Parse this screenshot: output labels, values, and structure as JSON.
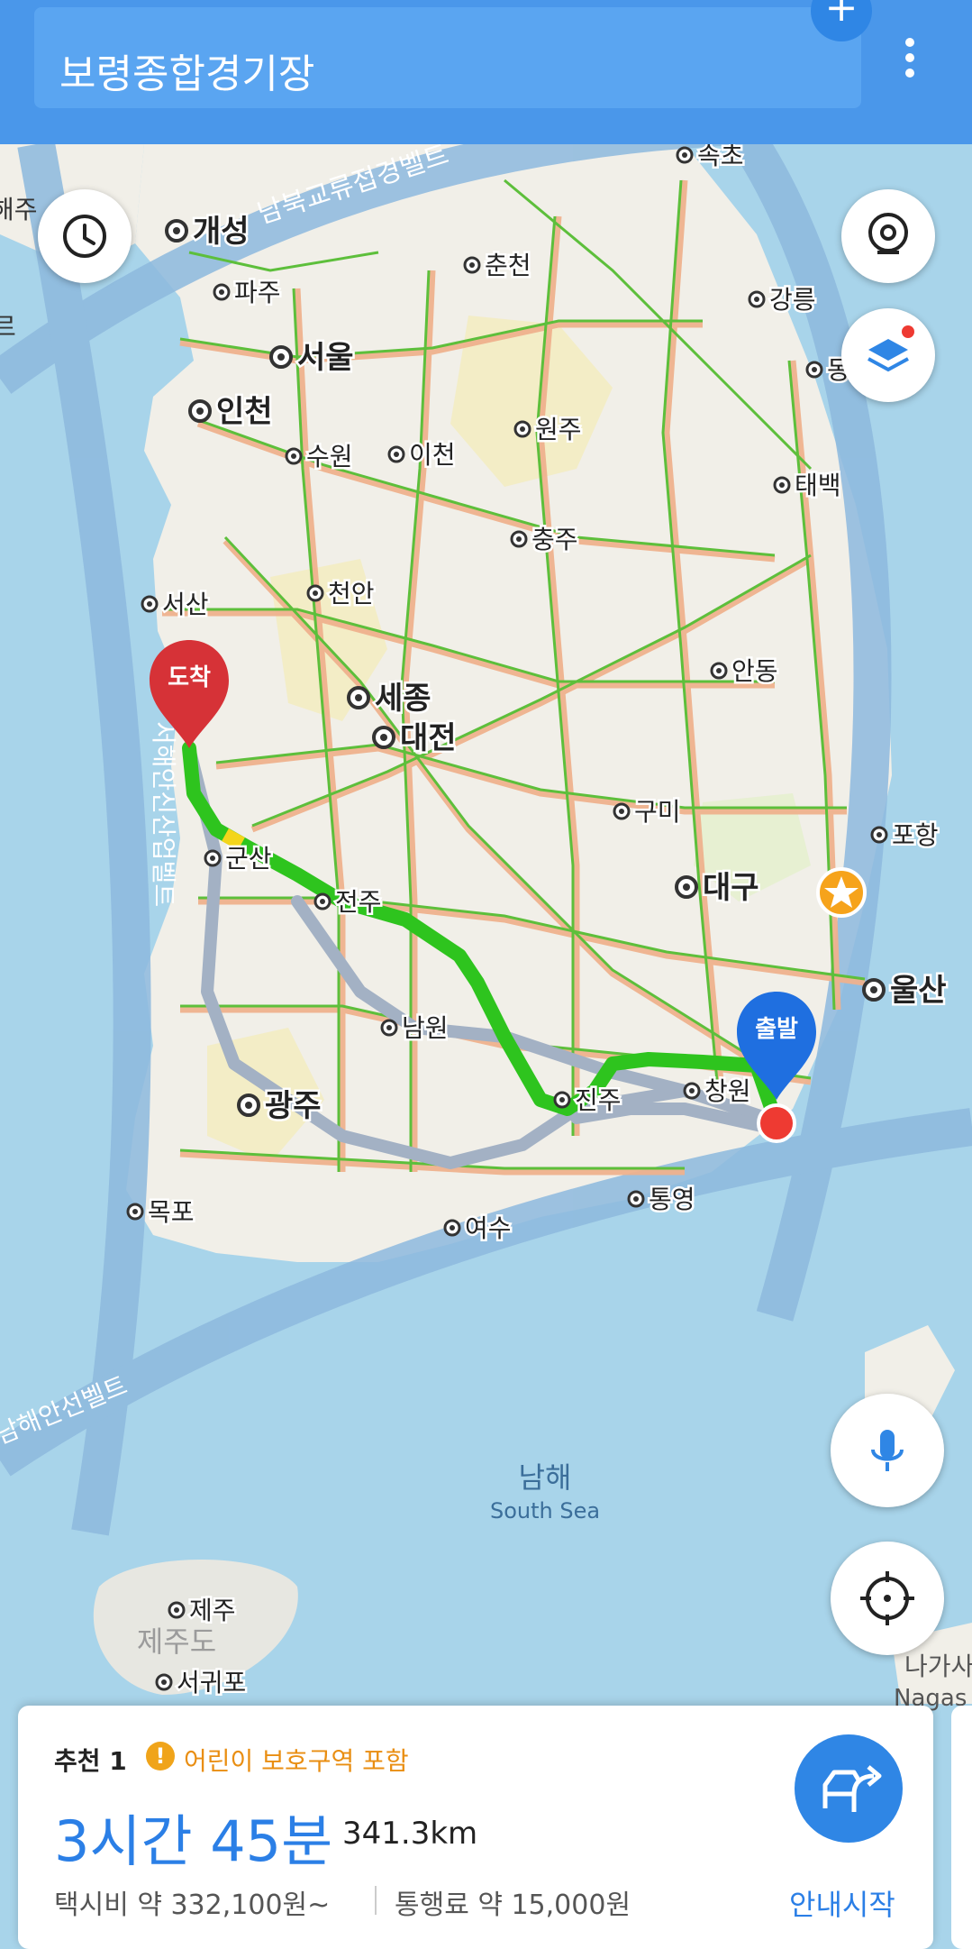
{
  "search": {
    "title": "보령종합경기장"
  },
  "map": {
    "roads": {
      "south_north": "남북교류접경벨트",
      "west_coast": "서해안신산업벨트",
      "south_coast": "남해안선벨트"
    },
    "sea": {
      "korean": "남해",
      "english": "South Sea"
    },
    "jeju_island": "제주도",
    "cities": [
      {
        "name": "속초"
      },
      {
        "name": "개성"
      },
      {
        "name": "춘천"
      },
      {
        "name": "파주"
      },
      {
        "name": "강릉"
      },
      {
        "name": "서울"
      },
      {
        "name": "인천"
      },
      {
        "name": "원주"
      },
      {
        "name": "수원"
      },
      {
        "name": "이천"
      },
      {
        "name": "태백"
      },
      {
        "name": "충주"
      },
      {
        "name": "서산"
      },
      {
        "name": "천안"
      },
      {
        "name": "안동"
      },
      {
        "name": "세종"
      },
      {
        "name": "대전"
      },
      {
        "name": "구미"
      },
      {
        "name": "포항"
      },
      {
        "name": "군산"
      },
      {
        "name": "대구"
      },
      {
        "name": "전주"
      },
      {
        "name": "울산"
      },
      {
        "name": "남원"
      },
      {
        "name": "진주"
      },
      {
        "name": "창원"
      },
      {
        "name": "광주"
      },
      {
        "name": "통영"
      },
      {
        "name": "목포"
      },
      {
        "name": "여수"
      },
      {
        "name": "제주"
      },
      {
        "name": "서귀포"
      },
      {
        "name": "동"
      }
    ],
    "nagasaki": {
      "line1": "나가사",
      "line2": "Nagas"
    },
    "edge_labels": {
      "left1": "해주",
      "left2": "르"
    },
    "markers": {
      "arrival": "도착",
      "departure": "출발"
    },
    "colors": {
      "route": "#2ec41e",
      "alt_route": "#a3b1c4",
      "arrival_pin": "#d63237",
      "departure_pin": "#1f6fe0",
      "sea": "#a8d4ea",
      "land": "#f1efe8"
    }
  },
  "route_card": {
    "rank": "추천 1",
    "warning": "어린이 보호구역 포함",
    "warning_icon": "!",
    "duration": "3시간 45분",
    "distance": "341.3km",
    "taxi_fare": "택시비 약 332,100원~",
    "toll": "통행료 약 15,000원",
    "start_button": "안내시작"
  },
  "buttons": {
    "add": "+"
  }
}
